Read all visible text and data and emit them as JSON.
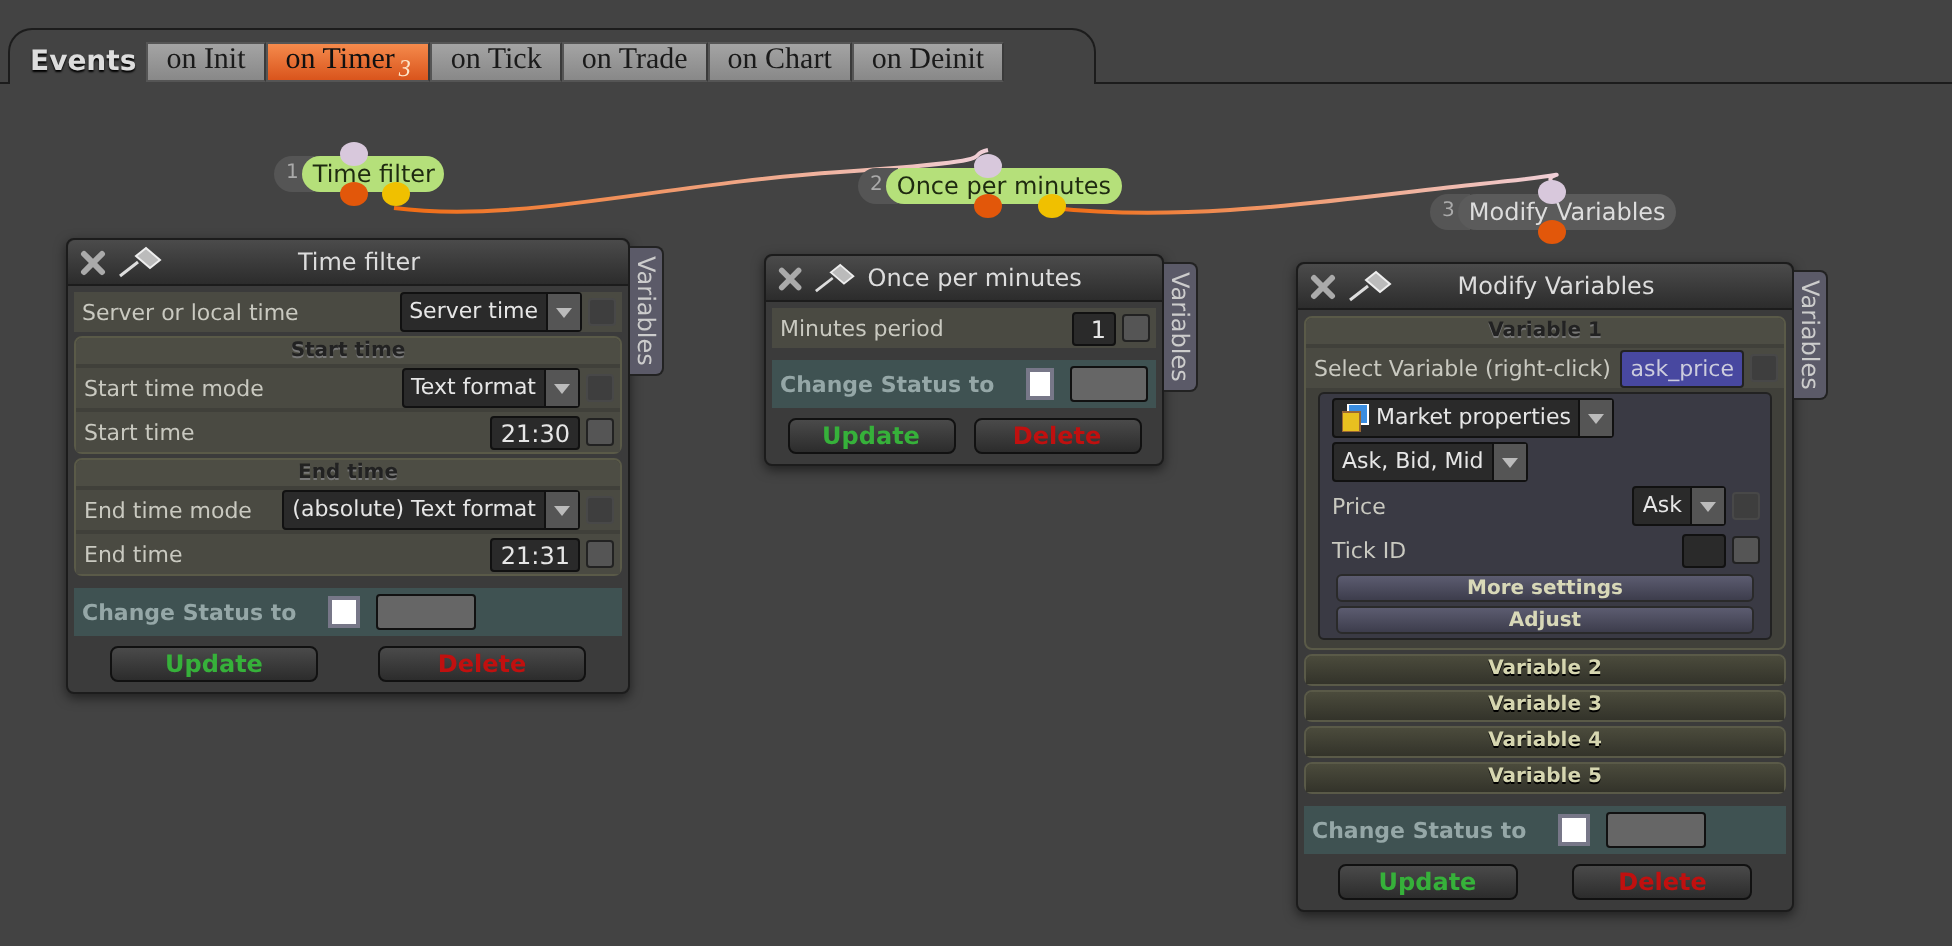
{
  "events": {
    "label": "Events",
    "tabs": [
      {
        "label": "on Init",
        "selected": false
      },
      {
        "label": "on Timer",
        "selected": true,
        "badge": "3"
      },
      {
        "label": "on Tick",
        "selected": false
      },
      {
        "label": "on Trade",
        "selected": false
      },
      {
        "label": "on Chart",
        "selected": false
      },
      {
        "label": "on Deinit",
        "selected": false
      }
    ]
  },
  "nodes": [
    {
      "number": "1",
      "label": "Time filter",
      "active": true
    },
    {
      "number": "2",
      "label": "Once per minutes",
      "active": true
    },
    {
      "number": "3",
      "label": "Modify Variables",
      "active": false
    }
  ],
  "panels": [
    {
      "title": "Time filter",
      "side_tab": "Variables",
      "rows": [
        {
          "kind": "select",
          "label": "Server or local time",
          "value": "Server time",
          "checked": false
        },
        {
          "kind": "group",
          "title": "Start time",
          "expanded": true,
          "rows": [
            {
              "kind": "select",
              "label": "Start time mode",
              "value": "Text format",
              "checked": false
            },
            {
              "kind": "input",
              "label": "Start time",
              "value": "21:30",
              "checked": false
            }
          ]
        },
        {
          "kind": "group",
          "title": "End time",
          "expanded": true,
          "rows": [
            {
              "kind": "select",
              "label": "End time mode",
              "value": "(absolute) Text format",
              "checked": false
            },
            {
              "kind": "input",
              "label": "End time",
              "value": "21:31",
              "checked": false
            }
          ]
        }
      ],
      "status": {
        "label": "Change Status to",
        "checked": false
      },
      "buttons": [
        {
          "label": "Update",
          "kind": "update"
        },
        {
          "label": "Delete",
          "kind": "delete"
        }
      ]
    },
    {
      "title": "Once per minutes",
      "side_tab": "Variables",
      "rows": [
        {
          "kind": "input",
          "label": "Minutes period",
          "value": "1",
          "checked": false
        }
      ],
      "status": {
        "label": "Change Status to",
        "checked": false
      },
      "buttons": [
        {
          "label": "Update",
          "kind": "update"
        },
        {
          "label": "Delete",
          "kind": "delete"
        }
      ]
    },
    {
      "title": "Modify Variables",
      "side_tab": "Variables",
      "rows": [
        {
          "kind": "group",
          "title": "Variable 1",
          "expanded": true,
          "rows": [
            {
              "kind": "variable",
              "label": "Select Variable (right-click)",
              "value": "ask_price",
              "checked": false
            },
            {
              "kind": "subpanel",
              "rows": [
                {
                  "kind": "iconselect",
                  "value": "Market properties"
                },
                {
                  "kind": "plainselect",
                  "value": "Ask, Bid, Mid"
                },
                {
                  "kind": "select",
                  "label": "Price",
                  "value": "Ask",
                  "checked": false
                },
                {
                  "kind": "input",
                  "label": "Tick ID",
                  "checked": false
                },
                {
                  "kind": "button",
                  "label": "More settings"
                },
                {
                  "kind": "button",
                  "label": "Adjust"
                }
              ]
            }
          ]
        },
        {
          "kind": "group",
          "title": "Variable 2",
          "expanded": false
        },
        {
          "kind": "group",
          "title": "Variable 3",
          "expanded": false
        },
        {
          "kind": "group",
          "title": "Variable 4",
          "expanded": false
        },
        {
          "kind": "group",
          "title": "Variable 5",
          "expanded": false
        }
      ],
      "status": {
        "label": "Change Status to",
        "checked": false
      },
      "buttons": [
        {
          "label": "Update",
          "kind": "update"
        },
        {
          "label": "Delete",
          "kind": "delete"
        }
      ]
    }
  ]
}
